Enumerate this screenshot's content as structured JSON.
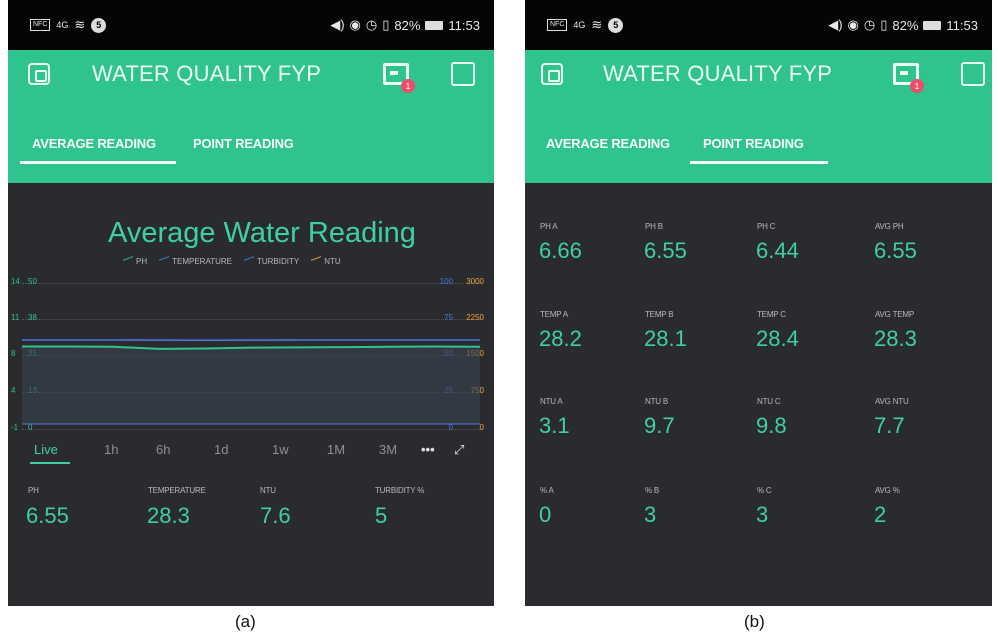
{
  "statusbar": {
    "chip": "NFC",
    "signal": "4G",
    "badge": "5",
    "battery": "82%",
    "time": "11:53"
  },
  "app": {
    "title": "WATER QUALITY FYP",
    "notification_count": "1"
  },
  "tabs": [
    "AVERAGE READING",
    "POINT READING"
  ],
  "panel_a": {
    "chart_data": {
      "type": "line",
      "title": "Average Water Reading",
      "series": [
        {
          "name": "PH",
          "values": [
            6.55,
            6.55,
            6.55,
            6.54,
            6.53,
            6.54,
            6.55,
            6.55,
            6.55,
            6.55,
            6.55
          ]
        },
        {
          "name": "TEMPERATURE",
          "values": [
            28.4,
            28.4,
            28.3,
            27.6,
            27.7,
            28.0,
            28.1,
            28.2,
            28.3,
            28.4,
            28.3
          ]
        },
        {
          "name": "TURBIDITY",
          "values": [
            0,
            0,
            0,
            0,
            0,
            0,
            0,
            0,
            0,
            0,
            0
          ]
        },
        {
          "name": "NTU",
          "values": [
            0,
            0,
            0,
            0,
            0,
            0,
            0,
            0,
            0,
            0,
            0
          ]
        }
      ],
      "y_left_ticks": [
        [
          "14",
          "50"
        ],
        [
          "11",
          "38"
        ],
        [
          "8",
          "25"
        ],
        [
          "4",
          "13"
        ],
        [
          "-1",
          "0"
        ]
      ],
      "y_right_ticks": [
        [
          "100",
          "3000"
        ],
        [
          "75",
          "2250"
        ],
        [
          "50",
          "1500"
        ],
        [
          "25",
          "750"
        ],
        [
          "0",
          "0"
        ]
      ],
      "ylim_temp": [
        0,
        50
      ],
      "grid": true,
      "legend": "top"
    },
    "ranges": [
      "Live",
      "1h",
      "6h",
      "1d",
      "1w",
      "1M",
      "3M",
      "•••"
    ],
    "readings": [
      {
        "label": "PH",
        "value": "6.55"
      },
      {
        "label": "TEMPERATURE",
        "value": "28.3"
      },
      {
        "label": "NTU",
        "value": "7.6"
      },
      {
        "label": "TURBIDITY %",
        "value": "5"
      }
    ]
  },
  "panel_b": {
    "rows": [
      [
        {
          "label": "PH A",
          "value": "6.66"
        },
        {
          "label": "PH B",
          "value": "6.55"
        },
        {
          "label": "PH C",
          "value": "6.44"
        },
        {
          "label": "AVG PH",
          "value": "6.55"
        }
      ],
      [
        {
          "label": "TEMP A",
          "value": "28.2"
        },
        {
          "label": "TEMP B",
          "value": "28.1"
        },
        {
          "label": "TEMP C",
          "value": "28.4"
        },
        {
          "label": "AVG TEMP",
          "value": "28.3"
        }
      ],
      [
        {
          "label": "NTU A",
          "value": "3.1"
        },
        {
          "label": "NTU B",
          "value": "9.7"
        },
        {
          "label": "NTU C",
          "value": "9.8"
        },
        {
          "label": "AVG NTU",
          "value": "7.7"
        }
      ],
      [
        {
          "label": "% A",
          "value": "0"
        },
        {
          "label": "% B",
          "value": "3"
        },
        {
          "label": "% C",
          "value": "3"
        },
        {
          "label": "AVG %",
          "value": "2"
        }
      ]
    ]
  },
  "captions": [
    "(a)",
    "(b)"
  ],
  "colors": {
    "accent": "#2fc38d",
    "value": "#3fd0a1",
    "background": "#2a2b2f",
    "ph": "#2fc38d",
    "temperature": "#4a78e6",
    "turbidity": "#4a78e6",
    "ntu": "#e8a637"
  }
}
